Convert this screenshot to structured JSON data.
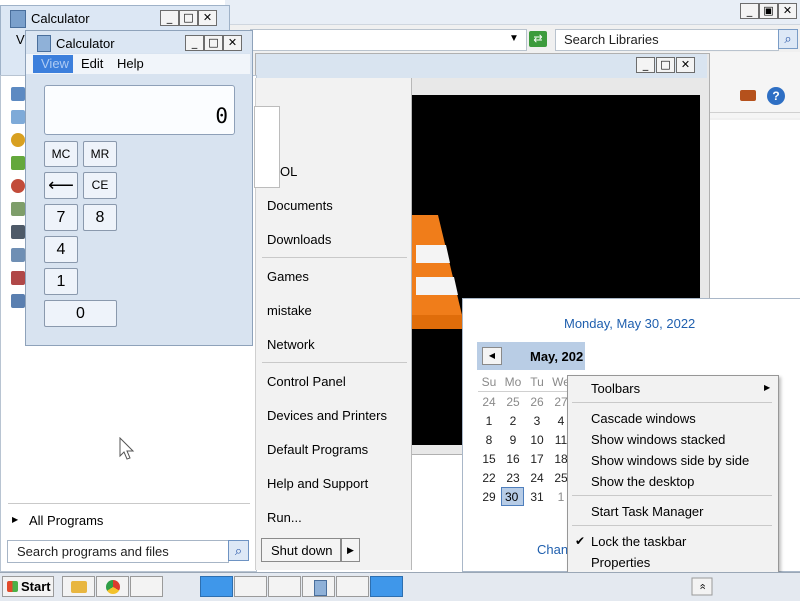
{
  "calc_back": {
    "title": "Calculator",
    "menu_partial": "Vi",
    "minimize": "_",
    "maximize": "□",
    "close": "✕"
  },
  "explorer": {
    "search_placeholder": "Search Libraries",
    "minimize": "_",
    "maximize": "▣",
    "close": "✕",
    "help_symbol": "?"
  },
  "media_window": {
    "minimize": "_",
    "maximize": "□",
    "close": "✕"
  },
  "calc_front": {
    "title": "Calculator",
    "menu": [
      "View",
      "Edit",
      "Help"
    ],
    "display": "0",
    "buttons": {
      "mc": "MC",
      "mr": "MR",
      "back": "⟵",
      "ce": "CE",
      "seven": "7",
      "eight": "8",
      "four": "4",
      "one": "1",
      "zero": "0"
    },
    "minimize": "_",
    "maximize": "□",
    "close": "✕"
  },
  "start_menu": {
    "right_items": {
      "partial_user": "OL",
      "documents": "Documents",
      "downloads": "Downloads",
      "games": "Games",
      "mistake": "mistake",
      "network": "Network",
      "control_panel": "Control Panel",
      "devices": "Devices and Printers",
      "default_programs": "Default Programs",
      "help": "Help and Support",
      "run": "Run..."
    },
    "all_programs": "All Programs",
    "search_placeholder": "Search programs and files",
    "shutdown": "Shut down",
    "shutdown_arrow": "▶"
  },
  "calendar": {
    "date_header": "Monday, May 30, 2022",
    "month_label": "May, 202",
    "prev_arrow": "◀",
    "weekdays": [
      "Su",
      "Mo",
      "Tu",
      "We"
    ],
    "rows": [
      [
        "24",
        "25",
        "26",
        "27"
      ],
      [
        "1",
        "2",
        "3",
        "4"
      ],
      [
        "8",
        "9",
        "10",
        "11"
      ],
      [
        "15",
        "16",
        "17",
        "18"
      ],
      [
        "22",
        "23",
        "24",
        "25"
      ],
      [
        "29",
        "30",
        "31",
        "1"
      ]
    ],
    "selected": "30",
    "change_link": "Chan"
  },
  "context_menu": {
    "toolbars": "Toolbars",
    "submenu_arrow": "▶",
    "cascade": "Cascade windows",
    "stacked": "Show windows stacked",
    "side_by_side": "Show windows side by side",
    "desktop": "Show the desktop",
    "task_manager": "Start Task Manager",
    "lock": "Lock the taskbar",
    "lock_check": "✔",
    "properties": "Properties"
  },
  "taskbar": {
    "start": "Start",
    "tray_chevron": "«"
  },
  "colors": {
    "title_bar": "#d7e4f2",
    "accent_blue": "#3a7bd5",
    "menu_border": "#979797"
  }
}
